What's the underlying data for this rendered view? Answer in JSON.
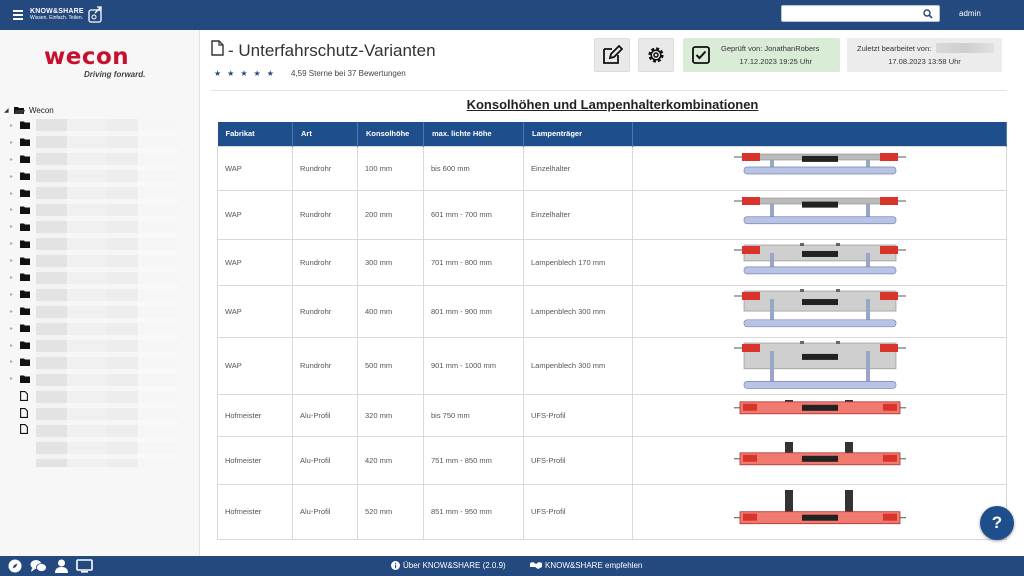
{
  "topbar": {
    "brand_main": "KNOW&SHARE",
    "brand_sub": "Wissen. Einfach. Teilen.",
    "search_placeholder": "",
    "user": "admin"
  },
  "sidebar": {
    "logo_word": "wecon",
    "logo_tagline": "Driving forward.",
    "tree_root": "Wecon",
    "tree_items": [
      {
        "type": "folder"
      },
      {
        "type": "folder"
      },
      {
        "type": "folder"
      },
      {
        "type": "folder"
      },
      {
        "type": "folder"
      },
      {
        "type": "folder"
      },
      {
        "type": "folder"
      },
      {
        "type": "folder"
      },
      {
        "type": "folder"
      },
      {
        "type": "folder"
      },
      {
        "type": "folder"
      },
      {
        "type": "folder"
      },
      {
        "type": "folder"
      },
      {
        "type": "folder"
      },
      {
        "type": "folder"
      },
      {
        "type": "folder"
      },
      {
        "type": "file"
      },
      {
        "type": "file"
      },
      {
        "type": "file"
      }
    ]
  },
  "page": {
    "title": "- Unterfahrschutz-Varianten",
    "rating_text": "4,59 Sterne bei 37 Bewertungen",
    "stars": 5,
    "checked_line1": "Geprüft von: JonathanRobers",
    "checked_line2": "17.12.2023 19:25 Uhr",
    "edited_line1": "Zuletzt bearbeitet von:",
    "edited_line2": "17.08.2023 13:58 Uhr",
    "section_title": "Konsolhöhen und Lampenhalterkombinationen"
  },
  "table": {
    "headers": [
      "Fabrikat",
      "Art",
      "Konsolhöhe",
      "max. lichte Höhe",
      "Lampenträger",
      ""
    ],
    "rows": [
      {
        "fabrikat": "WAP",
        "art": "Rundrohr",
        "konsol": "100 mm",
        "hoehe": "bis 600 mm",
        "traeger": "Einzelhalter",
        "style": "wap-single",
        "drop": 0.15
      },
      {
        "fabrikat": "WAP",
        "art": "Rundrohr",
        "konsol": "200 mm",
        "hoehe": "601 mm - 700 mm",
        "traeger": "Einzelhalter",
        "style": "wap-single",
        "drop": 0.35
      },
      {
        "fabrikat": "WAP",
        "art": "Rundrohr",
        "konsol": "300 mm",
        "hoehe": "701 mm - 800 mm",
        "traeger": "Lampenblech 170 mm",
        "style": "wap-plate",
        "drop": 0.45
      },
      {
        "fabrikat": "WAP",
        "art": "Rundrohr",
        "konsol": "400 mm",
        "hoehe": "801 mm - 900 mm",
        "traeger": "Lampenblech 300 mm",
        "style": "wap-plate",
        "drop": 0.6
      },
      {
        "fabrikat": "WAP",
        "art": "Rundrohr",
        "konsol": "500 mm",
        "hoehe": "901 mm - 1000 mm",
        "traeger": "Lampenblech 300 mm",
        "style": "wap-plate",
        "drop": 0.8
      },
      {
        "fabrikat": "Hofmeister",
        "art": "Alu-Profil",
        "konsol": "320 mm",
        "hoehe": "bis 750 mm",
        "traeger": "UFS-Profil",
        "style": "hof",
        "drop": 0.1
      },
      {
        "fabrikat": "Hofmeister",
        "art": "Alu-Profil",
        "konsol": "420 mm",
        "hoehe": "751 mm - 850 mm",
        "traeger": "UFS-Profil",
        "style": "hof",
        "drop": 0.45
      },
      {
        "fabrikat": "Hofmeister",
        "art": "Alu-Profil",
        "konsol": "520 mm",
        "hoehe": "851 mm - 950 mm",
        "traeger": "UFS-Profil",
        "style": "hof",
        "drop": 0.7
      }
    ]
  },
  "help_label": "?",
  "footer": {
    "about": "Über KNOW&SHARE (2.0.9)",
    "recommend": "KNOW&SHARE empfehlen"
  },
  "colors": {
    "primary": "#23497e",
    "table_header": "#1f4e8c",
    "checked_bg": "#d8ecd6",
    "lamp_red": "#d9342b",
    "hof_body": "#f07a6f"
  }
}
